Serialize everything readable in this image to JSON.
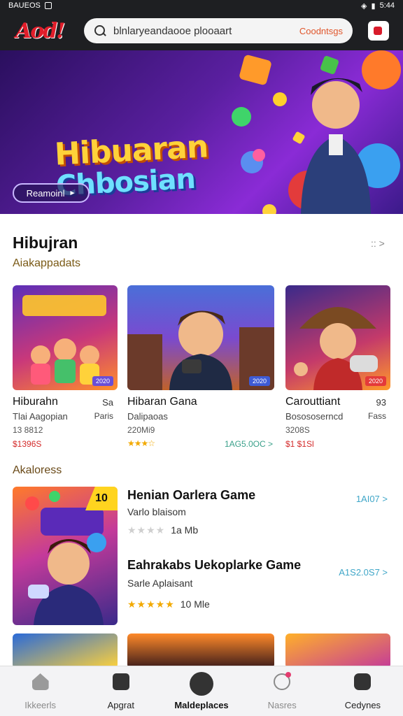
{
  "status_bar": {
    "left": "BAUEOS",
    "right": "5:44"
  },
  "app_bar": {
    "logo_text": "Aod!",
    "search_placeholder": "blnlaryeandaooe plooaart",
    "search_action": "Coodntsgs"
  },
  "hero": {
    "title_line1": "Hibuaran",
    "title_line2": "Chbosian",
    "button_label": "Reamoinl",
    "button_arrow": "►"
  },
  "section1": {
    "title": "Hibujran",
    "subtitle": "Aiakappadats",
    "more_icon": "chevron-right-icon",
    "more_text": "::",
    "cards": [
      {
        "name": "Hiburahn",
        "extra": "Sa",
        "category": "Tlai Aagopian",
        "category2": "Paris",
        "meta": "13 8812",
        "price": "$1396S",
        "badge": "2020",
        "badge_color": "#6a4ed6"
      },
      {
        "name": "Hibaran Gana",
        "extra": "",
        "category": "Dalipaoas",
        "category2": "",
        "meta": "220Mi9",
        "stars": "★★★☆",
        "link": "1AG5.0OC >",
        "badge": "2020",
        "badge_color": "#3e5bd6"
      },
      {
        "name": "Carouttiant",
        "extra": "93",
        "category": "Bosososerncd",
        "category2": "Fass",
        "meta": "3208S",
        "price": "$1 $1Sl",
        "badge": "2020",
        "badge_color": "#e43a3a"
      }
    ]
  },
  "section2": {
    "title": "Akaloress",
    "tag": "10",
    "items": [
      {
        "title": "Henian Oarlera Game",
        "subtitle": "Varlo blaisom",
        "stars_on": 0,
        "size": "1a Mb",
        "link": "1AI07 >"
      },
      {
        "title": "Eahrakabs Uekoplarke Game",
        "subtitle": "Sarle Aplaisant",
        "stars_on": 5,
        "size": "10 Mle",
        "link": "A1S2.0S7 >"
      }
    ]
  },
  "bottom_nav": [
    {
      "label": "Ikkeerls",
      "icon": "home-icon"
    },
    {
      "label": "Apgrat",
      "icon": "gamepad-icon"
    },
    {
      "label": "Maldeplaces",
      "icon": "store-icon",
      "active": true
    },
    {
      "label": "Nasres",
      "icon": "bell-icon"
    },
    {
      "label": "Cedynes",
      "icon": "profile-icon"
    }
  ]
}
